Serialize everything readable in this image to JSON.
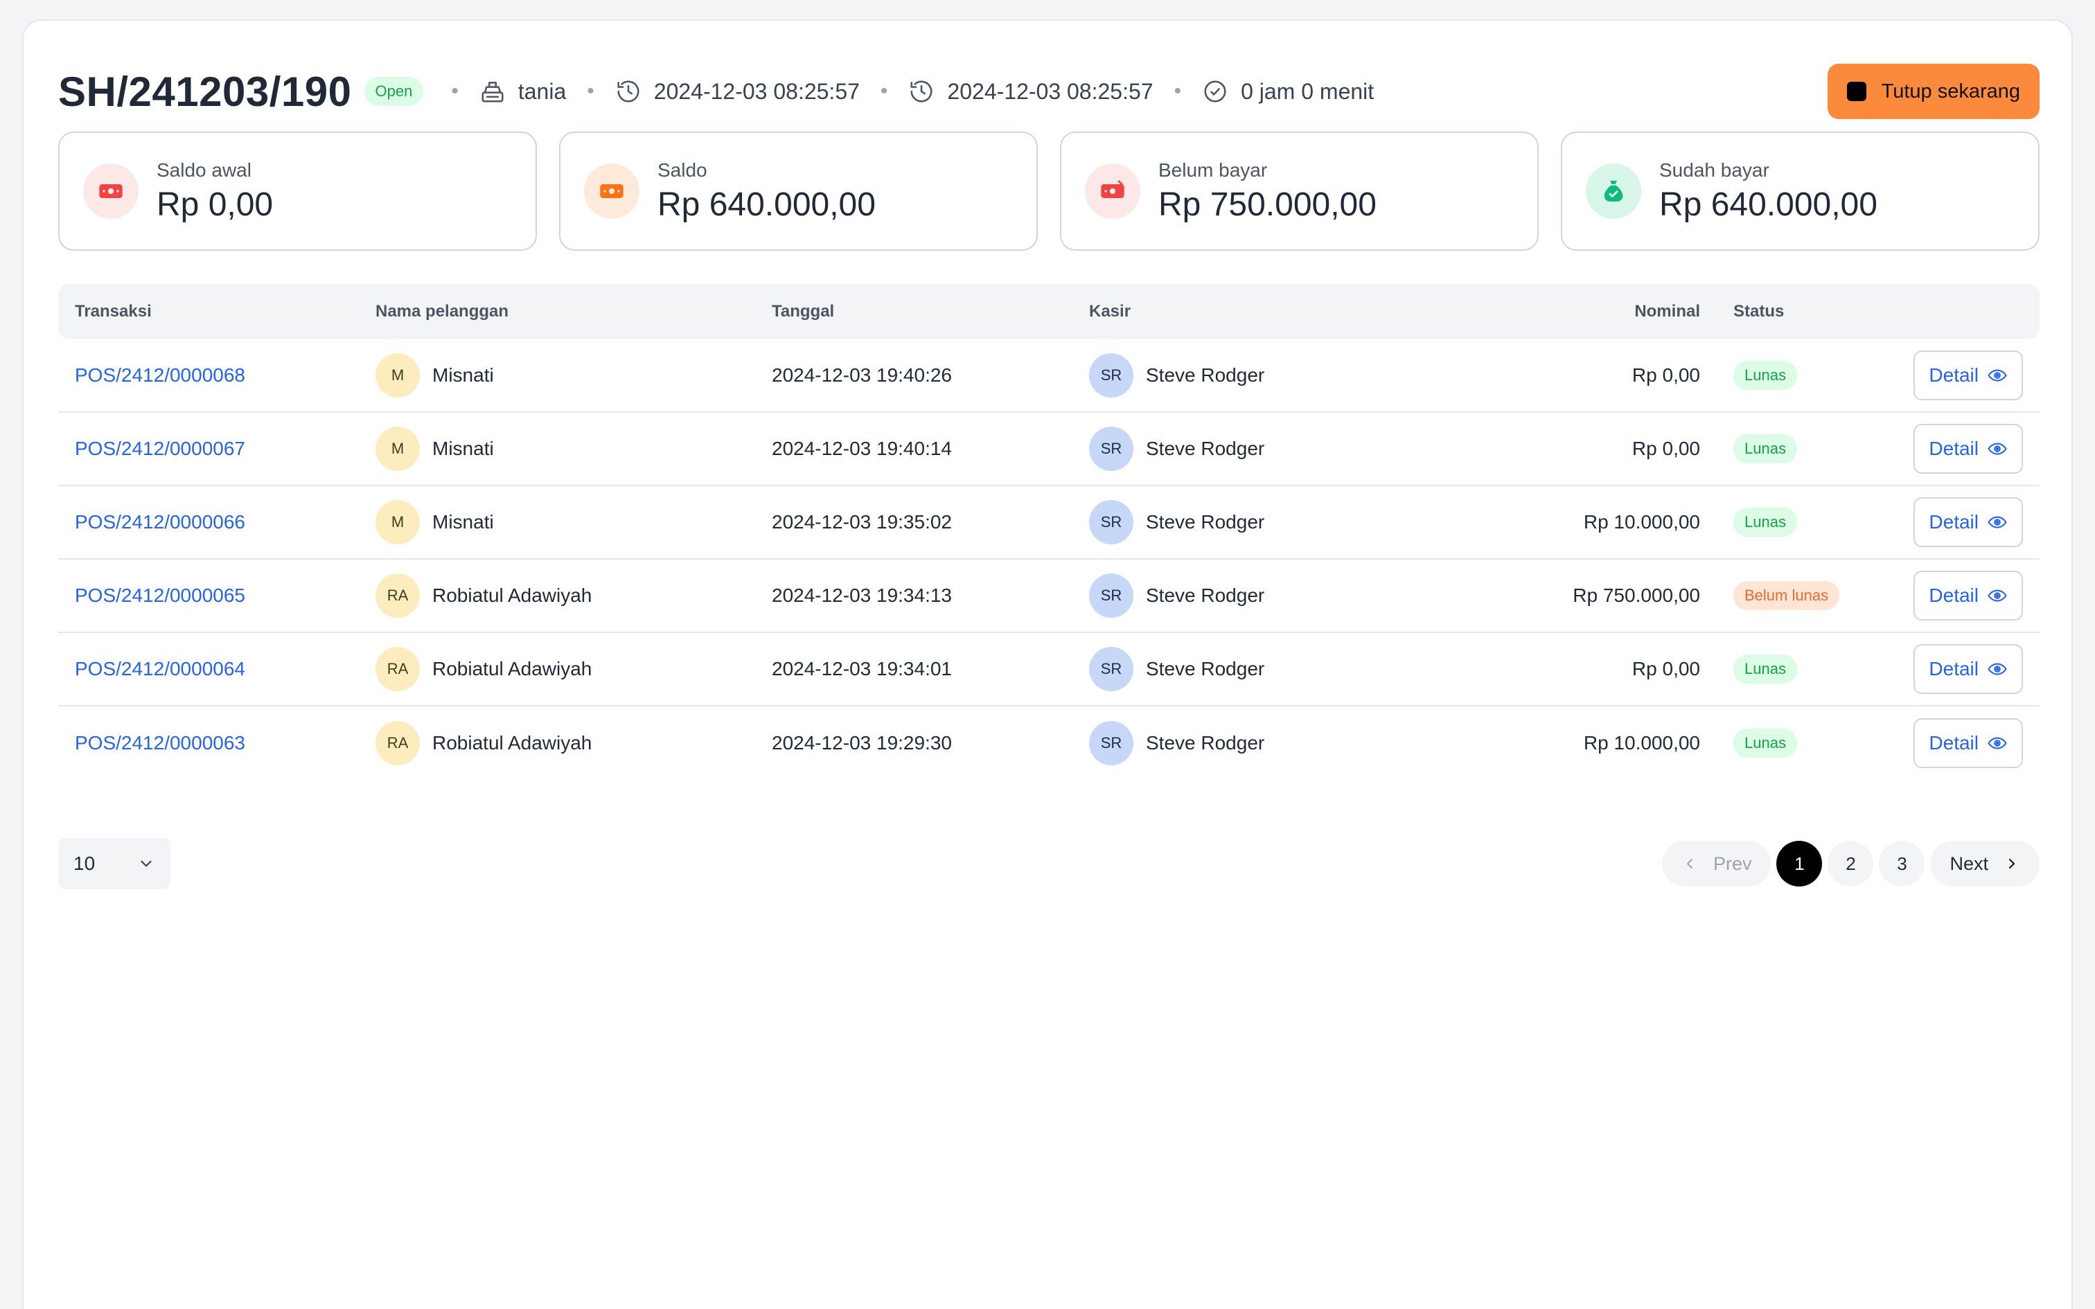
{
  "header": {
    "title": "SH/241203/190",
    "status": "Open",
    "cashier": "tania",
    "opened_at": "2024-12-03 08:25:57",
    "closed_at": "2024-12-03 08:25:57",
    "duration": "0 jam 0 menit",
    "close_button": "Tutup sekarang"
  },
  "cards": [
    {
      "label": "Saldo awal",
      "value": "Rp 0,00",
      "icon": "money-icon",
      "color": "#ef4444",
      "bg": "#fde8e8"
    },
    {
      "label": "Saldo",
      "value": "Rp 640.000,00",
      "icon": "money-icon",
      "color": "#f97316",
      "bg": "#feeadb"
    },
    {
      "label": "Belum bayar",
      "value": "Rp 750.000,00",
      "icon": "money-out-icon",
      "color": "#ef4444",
      "bg": "#fde8e8"
    },
    {
      "label": "Sudah bayar",
      "value": "Rp 640.000,00",
      "icon": "money-bag-check-icon",
      "color": "#10b981",
      "bg": "#d8f7e8"
    }
  ],
  "table": {
    "headers": {
      "transaksi": "Transaksi",
      "pelanggan": "Nama pelanggan",
      "tanggal": "Tanggal",
      "kasir": "Kasir",
      "nominal": "Nominal",
      "status": "Status"
    },
    "detail_label": "Detail",
    "rows": [
      {
        "id": "POS/2412/0000068",
        "initials": "M",
        "customer": "Misnati",
        "date": "2024-12-03 19:40:26",
        "cashier_initials": "SR",
        "cashier": "Steve Rodger",
        "amount": "Rp 0,00",
        "status": "Lunas",
        "status_type": "paid"
      },
      {
        "id": "POS/2412/0000067",
        "initials": "M",
        "customer": "Misnati",
        "date": "2024-12-03 19:40:14",
        "cashier_initials": "SR",
        "cashier": "Steve Rodger",
        "amount": "Rp 0,00",
        "status": "Lunas",
        "status_type": "paid"
      },
      {
        "id": "POS/2412/0000066",
        "initials": "M",
        "customer": "Misnati",
        "date": "2024-12-03 19:35:02",
        "cashier_initials": "SR",
        "cashier": "Steve Rodger",
        "amount": "Rp 10.000,00",
        "status": "Lunas",
        "status_type": "paid"
      },
      {
        "id": "POS/2412/0000065",
        "initials": "RA",
        "customer": "Robiatul Adawiyah",
        "date": "2024-12-03 19:34:13",
        "cashier_initials": "SR",
        "cashier": "Steve Rodger",
        "amount": "Rp 750.000,00",
        "status": "Belum lunas",
        "status_type": "unpaid"
      },
      {
        "id": "POS/2412/0000064",
        "initials": "RA",
        "customer": "Robiatul Adawiyah",
        "date": "2024-12-03 19:34:01",
        "cashier_initials": "SR",
        "cashier": "Steve Rodger",
        "amount": "Rp 0,00",
        "status": "Lunas",
        "status_type": "paid"
      },
      {
        "id": "POS/2412/0000063",
        "initials": "RA",
        "customer": "Robiatul Adawiyah",
        "date": "2024-12-03 19:29:30",
        "cashier_initials": "SR",
        "cashier": "Steve Rodger",
        "amount": "Rp 10.000,00",
        "status": "Lunas",
        "status_type": "paid"
      }
    ]
  },
  "pagination": {
    "per_page": "10",
    "prev": "Prev",
    "next": "Next",
    "pages": [
      "1",
      "2",
      "3"
    ],
    "current": "1"
  }
}
